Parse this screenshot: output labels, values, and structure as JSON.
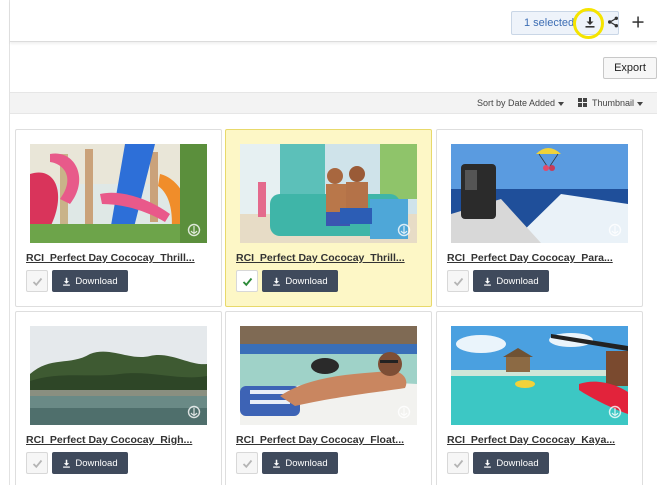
{
  "toolbar": {
    "selected_label": "1 selected",
    "icons": [
      "download-icon",
      "share-icon",
      "plus-icon"
    ],
    "highlight_color": "#f5e400"
  },
  "export_label": "Export",
  "sort": {
    "sort_label": "Sort by Date Added",
    "view_label": "Thumbnail"
  },
  "download_label": "Download",
  "assets": [
    {
      "title": "RCI_Perfect Day Cococay_Thrill...",
      "selected": false,
      "scene": "water-park"
    },
    {
      "title": "RCI_Perfect Day Cococay_Thrill...",
      "selected": true,
      "scene": "couple-float"
    },
    {
      "title": "RCI_Perfect Day Cococay_Para...",
      "selected": false,
      "scene": "boat-parasail"
    },
    {
      "title": "RCI_Perfect Day Cococay_Righ...",
      "selected": false,
      "scene": "island-shore"
    },
    {
      "title": "RCI_Perfect Day Cococay_Float...",
      "selected": false,
      "scene": "man-float"
    },
    {
      "title": "RCI_Perfect Day Cococay_Kaya...",
      "selected": false,
      "scene": "kayak-beach"
    }
  ],
  "colors": {
    "accent": "#3d6eb4",
    "download_button": "#3f4a5c",
    "selected_card": "#fdf7c6",
    "check_selected": "#2e8b3a"
  }
}
